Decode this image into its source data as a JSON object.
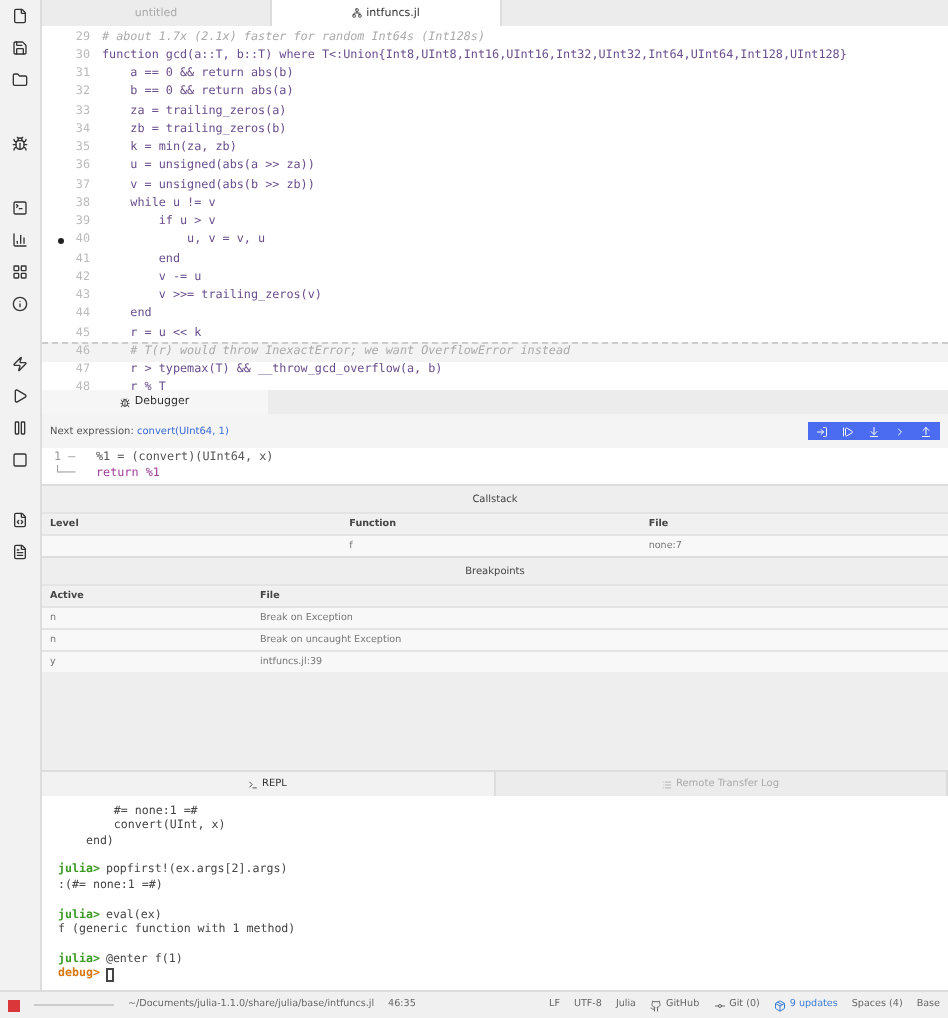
{
  "tabs": [
    {
      "label": "untitled",
      "selected": false
    },
    {
      "label": "intfuncs.jl",
      "selected": true
    }
  ],
  "editor": {
    "lines": [
      {
        "number": "29",
        "text": "# about 1.7x (2.1x) faster for random Int64s (Int128s)",
        "kind": "comment",
        "current": false,
        "breakpoint": false
      },
      {
        "number": "30",
        "text": "function gcd(a::T, b::T) where T<:Union{Int8,UInt8,Int16,UInt16,Int32,UInt32,Int64,UInt64,Int128,UInt128}",
        "kind": "code",
        "current": false,
        "breakpoint": false
      },
      {
        "number": "31",
        "text": "    a == 0 && return abs(b)",
        "kind": "code",
        "current": false,
        "breakpoint": false
      },
      {
        "number": "32",
        "text": "    b == 0 && return abs(a)",
        "kind": "code",
        "current": false,
        "breakpoint": false
      },
      {
        "number": "33",
        "text": "    za = trailing_zeros(a)",
        "kind": "code",
        "current": false,
        "breakpoint": false
      },
      {
        "number": "34",
        "text": "    zb = trailing_zeros(b)",
        "kind": "code",
        "current": false,
        "breakpoint": false
      },
      {
        "number": "35",
        "text": "    k = min(za, zb)",
        "kind": "code",
        "current": false,
        "breakpoint": false
      },
      {
        "number": "36",
        "text": "    u = unsigned(abs(a >> za))",
        "kind": "code",
        "current": false,
        "breakpoint": false
      },
      {
        "number": "37",
        "text": "    v = unsigned(abs(b >> zb))",
        "kind": "code",
        "current": false,
        "breakpoint": false
      },
      {
        "number": "38",
        "text": "    while u != v",
        "kind": "code",
        "current": false,
        "breakpoint": false
      },
      {
        "number": "39",
        "text": "        if u > v",
        "kind": "code",
        "current": false,
        "breakpoint": false
      },
      {
        "number": "40",
        "text": "            u, v = v, u",
        "kind": "code",
        "current": false,
        "breakpoint": true
      },
      {
        "number": "41",
        "text": "        end",
        "kind": "code",
        "current": false,
        "breakpoint": false
      },
      {
        "number": "42",
        "text": "        v -= u",
        "kind": "code",
        "current": false,
        "breakpoint": false
      },
      {
        "number": "43",
        "text": "        v >>= trailing_zeros(v)",
        "kind": "code",
        "current": false,
        "breakpoint": false
      },
      {
        "number": "44",
        "text": "    end",
        "kind": "code",
        "current": false,
        "breakpoint": false
      },
      {
        "number": "45",
        "text": "    r = u << k",
        "kind": "code",
        "current": false,
        "breakpoint": false
      },
      {
        "number": "46",
        "text": "    # T(r) would throw InexactError; we want OverflowError instead",
        "kind": "comment",
        "current": true,
        "breakpoint": false
      },
      {
        "number": "47",
        "text": "    r > typemax(T) && __throw_gcd_overflow(a, b)",
        "kind": "code",
        "current": false,
        "breakpoint": false
      },
      {
        "number": "48",
        "text": "    r % T",
        "kind": "code",
        "current": false,
        "breakpoint": false
      }
    ]
  },
  "debugger": {
    "tab": "Debugger",
    "next_label": "Next expression:",
    "next_expr": "convert(UInt64, 1)",
    "code": [
      {
        "gutter": "1 —",
        "text": "%1 = (convert)(UInt64, x)"
      },
      {
        "gutter": "└──",
        "text": "return %1"
      }
    ],
    "callstack": {
      "title": "Callstack",
      "columns": [
        "Level",
        "Function",
        "File"
      ],
      "rows": [
        [
          "",
          "f",
          "none:7"
        ]
      ]
    },
    "breakpoints": {
      "title": "Breakpoints",
      "columns": [
        "Active",
        "File"
      ],
      "rows": [
        [
          "n",
          "Break on Exception"
        ],
        [
          "n",
          "Break on uncaught Exception"
        ],
        [
          "y",
          "intfuncs.jl:39"
        ]
      ]
    }
  },
  "bottom_tabs": [
    {
      "label": "REPL",
      "selected": true
    },
    {
      "label": "Remote Transfer Log",
      "selected": false
    }
  ],
  "repl": [
    {
      "kind": "output",
      "text": "        #= none:1 =#"
    },
    {
      "kind": "output",
      "text": "        convert(UInt, x)"
    },
    {
      "kind": "output",
      "text": "    end)"
    },
    {
      "kind": "blank"
    },
    {
      "kind": "input",
      "prompt": "julia>",
      "text": "popfirst!(ex.args[2].args)"
    },
    {
      "kind": "output",
      "text": ":(#= none:1 =#)"
    },
    {
      "kind": "blank"
    },
    {
      "kind": "input",
      "prompt": "julia>",
      "text": "eval(ex)"
    },
    {
      "kind": "output",
      "text": "f (generic function with 1 method)"
    },
    {
      "kind": "blank"
    },
    {
      "kind": "input",
      "prompt": "julia>",
      "text": "@enter f(1)"
    },
    {
      "kind": "debug",
      "prompt": "debug>"
    }
  ],
  "status_bar": {
    "path": "~/Documents/julia-1.1.0/share/julia/base/intfuncs.jl",
    "cursor": "46:35",
    "items": [
      "LF",
      "UTF-8",
      "Julia"
    ],
    "github": "GitHub",
    "git": "Git (0)",
    "updates": "9 updates",
    "spaces": "Spaces (4)",
    "module": "Base"
  }
}
